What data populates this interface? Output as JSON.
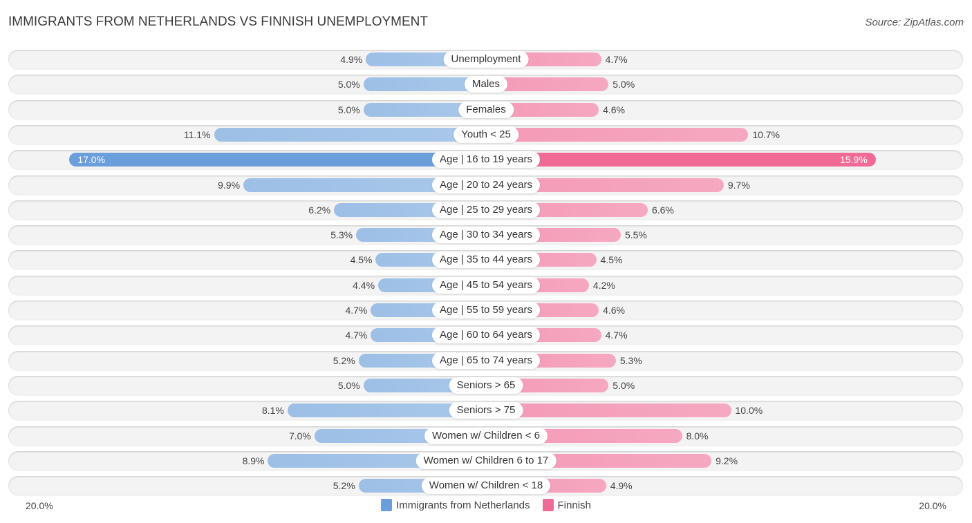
{
  "header": {
    "title": "IMMIGRANTS FROM NETHERLANDS VS FINNISH UNEMPLOYMENT",
    "source": "Source: ZipAtlas.com"
  },
  "colors": {
    "left": "#6a9fdc",
    "right": "#f06a96",
    "left_light": "#a9c8ea",
    "right_light": "#f6a8c0"
  },
  "chart_data": {
    "type": "bar",
    "orientation": "horizontal-diverging",
    "title": "IMMIGRANTS FROM NETHERLANDS VS FINNISH UNEMPLOYMENT",
    "xlabel": "",
    "ylabel": "",
    "axis_range": [
      -20.0,
      20.0
    ],
    "axis_labels": {
      "left": "20.0%",
      "right": "20.0%"
    },
    "legend_position": "bottom-center",
    "categories": [
      "Unemployment",
      "Males",
      "Females",
      "Youth < 25",
      "Age | 16 to 19 years",
      "Age | 20 to 24 years",
      "Age | 25 to 29 years",
      "Age | 30 to 34 years",
      "Age | 35 to 44 years",
      "Age | 45 to 54 years",
      "Age | 55 to 59 years",
      "Age | 60 to 64 years",
      "Age | 65 to 74 years",
      "Seniors > 65",
      "Seniors > 75",
      "Women w/ Children < 6",
      "Women w/ Children 6 to 17",
      "Women w/ Children < 18"
    ],
    "series": [
      {
        "name": "Immigrants from Netherlands",
        "side": "left",
        "values": [
          4.9,
          5.0,
          5.0,
          11.1,
          17.0,
          9.9,
          6.2,
          5.3,
          4.5,
          4.4,
          4.7,
          4.7,
          5.2,
          5.0,
          8.1,
          7.0,
          8.9,
          5.2
        ],
        "labels": [
          "4.9%",
          "5.0%",
          "5.0%",
          "11.1%",
          "17.0%",
          "9.9%",
          "6.2%",
          "5.3%",
          "4.5%",
          "4.4%",
          "4.7%",
          "4.7%",
          "5.2%",
          "5.0%",
          "8.1%",
          "7.0%",
          "8.9%",
          "5.2%"
        ]
      },
      {
        "name": "Finnish",
        "side": "right",
        "values": [
          4.7,
          5.0,
          4.6,
          10.7,
          15.9,
          9.7,
          6.6,
          5.5,
          4.5,
          4.2,
          4.6,
          4.7,
          5.3,
          5.0,
          10.0,
          8.0,
          9.2,
          4.9
        ],
        "labels": [
          "4.7%",
          "5.0%",
          "4.6%",
          "10.7%",
          "15.9%",
          "9.7%",
          "6.6%",
          "5.5%",
          "4.5%",
          "4.2%",
          "4.6%",
          "4.7%",
          "5.3%",
          "5.0%",
          "10.0%",
          "8.0%",
          "9.2%",
          "4.9%"
        ]
      }
    ]
  },
  "legend": {
    "items": [
      {
        "label": "Immigrants from Netherlands",
        "color": "#6a9fdc"
      },
      {
        "label": "Finnish",
        "color": "#f06a96"
      }
    ]
  }
}
